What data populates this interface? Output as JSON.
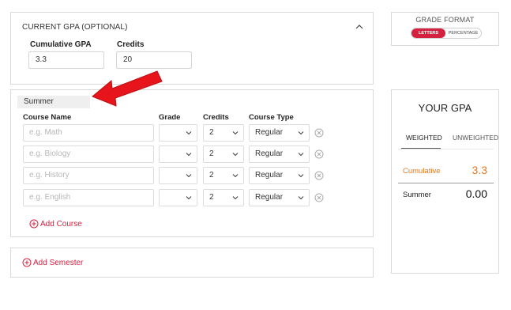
{
  "current_gpa": {
    "title": "CURRENT GPA (OPTIONAL)",
    "cumulative_label": "Cumulative GPA",
    "cumulative_value": "3.3",
    "credits_label": "Credits",
    "credits_value": "20"
  },
  "semester": {
    "name": "Summer",
    "columns": {
      "course": "Course Name",
      "grade": "Grade",
      "credits": "Credits",
      "type": "Course Type"
    },
    "rows": [
      {
        "placeholder": "e.g. Math",
        "grade": "",
        "credits": "2",
        "type": "Regular"
      },
      {
        "placeholder": "e.g. Biology",
        "grade": "",
        "credits": "2",
        "type": "Regular"
      },
      {
        "placeholder": "e.g. History",
        "grade": "",
        "credits": "2",
        "type": "Regular"
      },
      {
        "placeholder": "e.g. English",
        "grade": "",
        "credits": "2",
        "type": "Regular"
      }
    ],
    "add_course": "Add Course"
  },
  "add_semester": "Add Semester",
  "grade_format": {
    "title": "GRADE FORMAT",
    "letters": "LETTERS",
    "percentage": "PERCENTAGE",
    "selected": "LETTERS"
  },
  "result": {
    "title": "YOUR GPA",
    "tab_weighted": "WEIGHTED",
    "tab_unweighted": "UNWEIGHTED",
    "active_tab": "WEIGHTED",
    "cumulative_label": "Cumulative",
    "cumulative_value": "3.3",
    "semester_label": "Summer",
    "semester_value": "0.00"
  },
  "colors": {
    "accent": "#d4213f",
    "highlight": "#e8771a",
    "arrow": "#e8141b"
  },
  "icons": {
    "collapse": "chevron-up-icon",
    "remove": "remove-circle-icon",
    "add": "plus-circle-icon",
    "dropdown": "chevron-down-icon"
  }
}
